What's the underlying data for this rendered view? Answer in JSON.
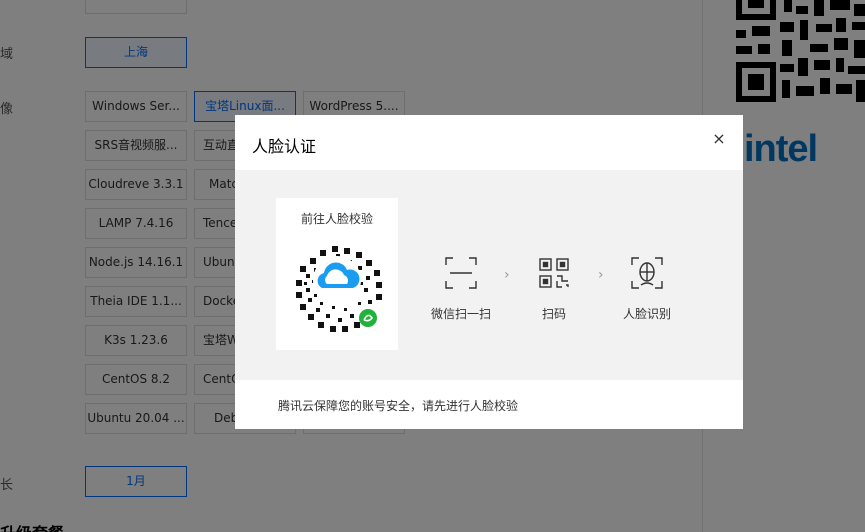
{
  "background": {
    "labels": [
      "域",
      "像",
      "长"
    ],
    "region_option": "上海",
    "image_options": [
      "Windows Ser...",
      "宝塔Linux面...",
      "WordPress 5....",
      "SRS音视频服...",
      "互动直",
      "Cloudreve 3.3.1",
      "Matc",
      "LAMP 7.4.16",
      "Tence",
      "Node.js 14.16.1",
      "Ubunt",
      "Theia IDE 1.1...",
      "Docke",
      "K3s 1.23.6",
      "宝塔W",
      "CentOS 8.2",
      "CentO",
      "Ubuntu 20.04 ...",
      "Deb"
    ],
    "duration_option": "1月",
    "package_title": "升级套餐",
    "brand_text": "intel"
  },
  "modal": {
    "title": "人脸认证",
    "close_glyph": "×",
    "qr_card_title": "前往人脸校验",
    "steps": [
      "微信扫一扫",
      "扫码",
      "人脸识别"
    ],
    "chevron": "›",
    "footer": "腾讯云保障您的账号安全，请先进行人脸校验",
    "accent_color": "#006eff"
  }
}
